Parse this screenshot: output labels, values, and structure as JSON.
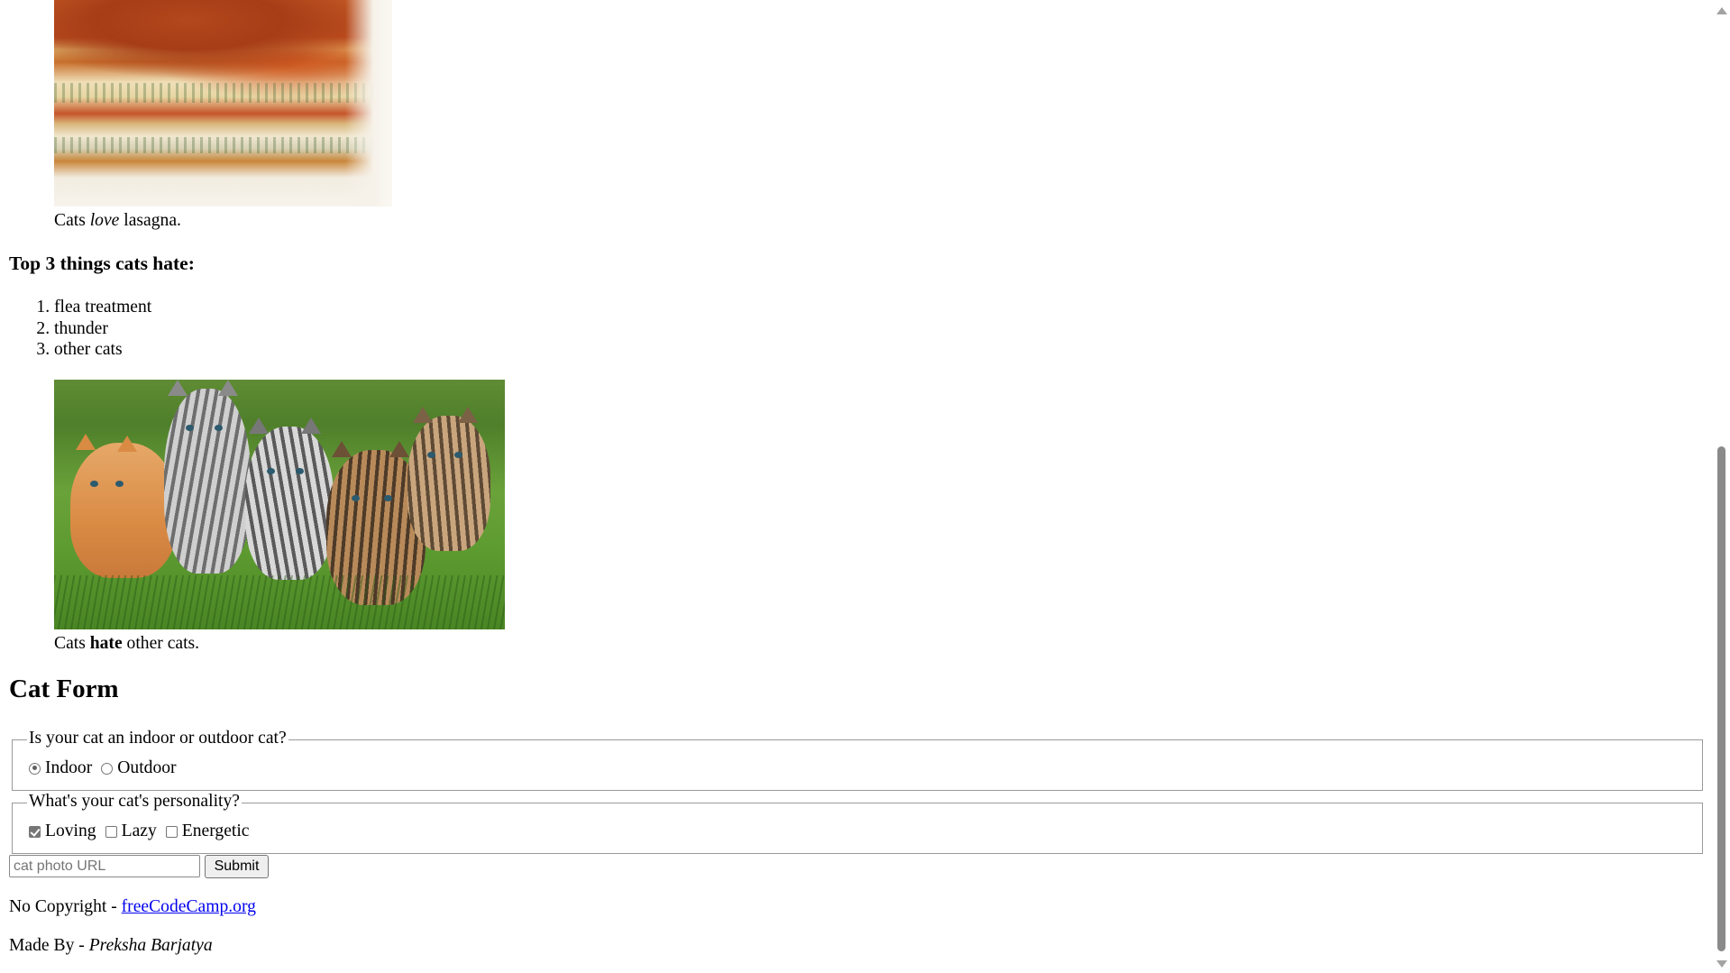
{
  "lasagna_caption": {
    "prefix": "Cats ",
    "emphasis": "love",
    "suffix": " lasagna."
  },
  "hate_section": {
    "heading": "Top 3 things cats hate:",
    "items": [
      "flea treatment",
      "thunder",
      "other cats"
    ]
  },
  "kittens_caption": {
    "prefix": "Cats ",
    "strong": "hate",
    "suffix": " other cats."
  },
  "form": {
    "heading": "Cat Form",
    "location_legend": "Is your cat an indoor or outdoor cat?",
    "location_options": [
      {
        "label": "Indoor",
        "checked": true
      },
      {
        "label": "Outdoor",
        "checked": false
      }
    ],
    "personality_legend": "What's your cat's personality?",
    "personality_options": [
      {
        "label": "Loving",
        "checked": true
      },
      {
        "label": "Lazy",
        "checked": false
      },
      {
        "label": "Energetic",
        "checked": false
      }
    ],
    "url_input": {
      "value": "",
      "placeholder": "cat photo URL"
    },
    "submit_label": "Submit"
  },
  "footer": {
    "copyright_prefix": "No Copyright - ",
    "link_text": "freeCodeCamp.org",
    "made_by_prefix": "Made By - ",
    "author": "Preksha Barjatya"
  },
  "colors": {
    "link": "#0000ee",
    "fieldset_border": "#9a9a9a",
    "button_bg": "#efefef"
  },
  "icons": {
    "scroll_up": "triangle-up-icon",
    "scroll_down": "triangle-down-icon"
  },
  "scroll_position": 0.46
}
